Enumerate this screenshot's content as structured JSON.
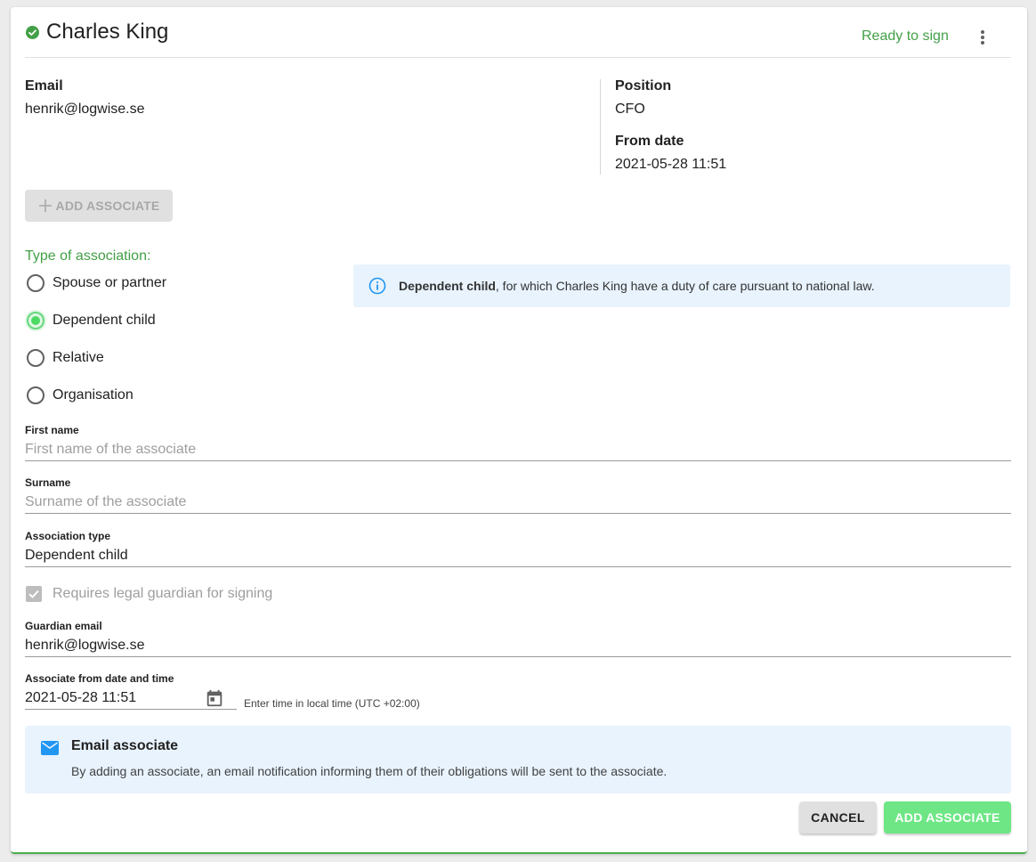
{
  "header": {
    "name": "Charles King",
    "status": "Ready to sign",
    "status_color": "#43a047"
  },
  "details": {
    "email_label": "Email",
    "email_value": "henrik@logwise.se",
    "position_label": "Position",
    "position_value": "CFO",
    "from_date_label": "From date",
    "from_date_value": "2021-05-28 11:51"
  },
  "add_associate_top_label": "ADD ASSOCIATE",
  "association": {
    "label": "Type of association:",
    "options": [
      {
        "label": "Spouse or partner",
        "checked": false
      },
      {
        "label": "Dependent child",
        "checked": true
      },
      {
        "label": "Relative",
        "checked": false
      },
      {
        "label": "Organisation",
        "checked": false
      }
    ],
    "info_bold": "Dependent child",
    "info_rest": ", for which Charles King have a duty of care pursuant to national law."
  },
  "form": {
    "first_name_label": "First name",
    "first_name_placeholder": "First name of the associate",
    "surname_label": "Surname",
    "surname_placeholder": "Surname of the associate",
    "association_type_label": "Association type",
    "association_type_value": "Dependent child",
    "guardian_checkbox_label": "Requires legal guardian for signing",
    "guardian_checkbox_checked": true,
    "guardian_email_label": "Guardian email",
    "guardian_email_value": "henrik@logwise.se",
    "from_datetime_label": "Associate from date and time",
    "from_datetime_value": "2021-05-28 11:51",
    "timezone_hint": "Enter time in local time (UTC +02:00)"
  },
  "email_notice": {
    "title": "Email associate",
    "text": "By adding an associate, an email notification informing them of their obligations will be sent to the associate."
  },
  "actions": {
    "cancel_label": "CANCEL",
    "add_label": "ADD ASSOCIATE",
    "accent": "#6ee685"
  }
}
